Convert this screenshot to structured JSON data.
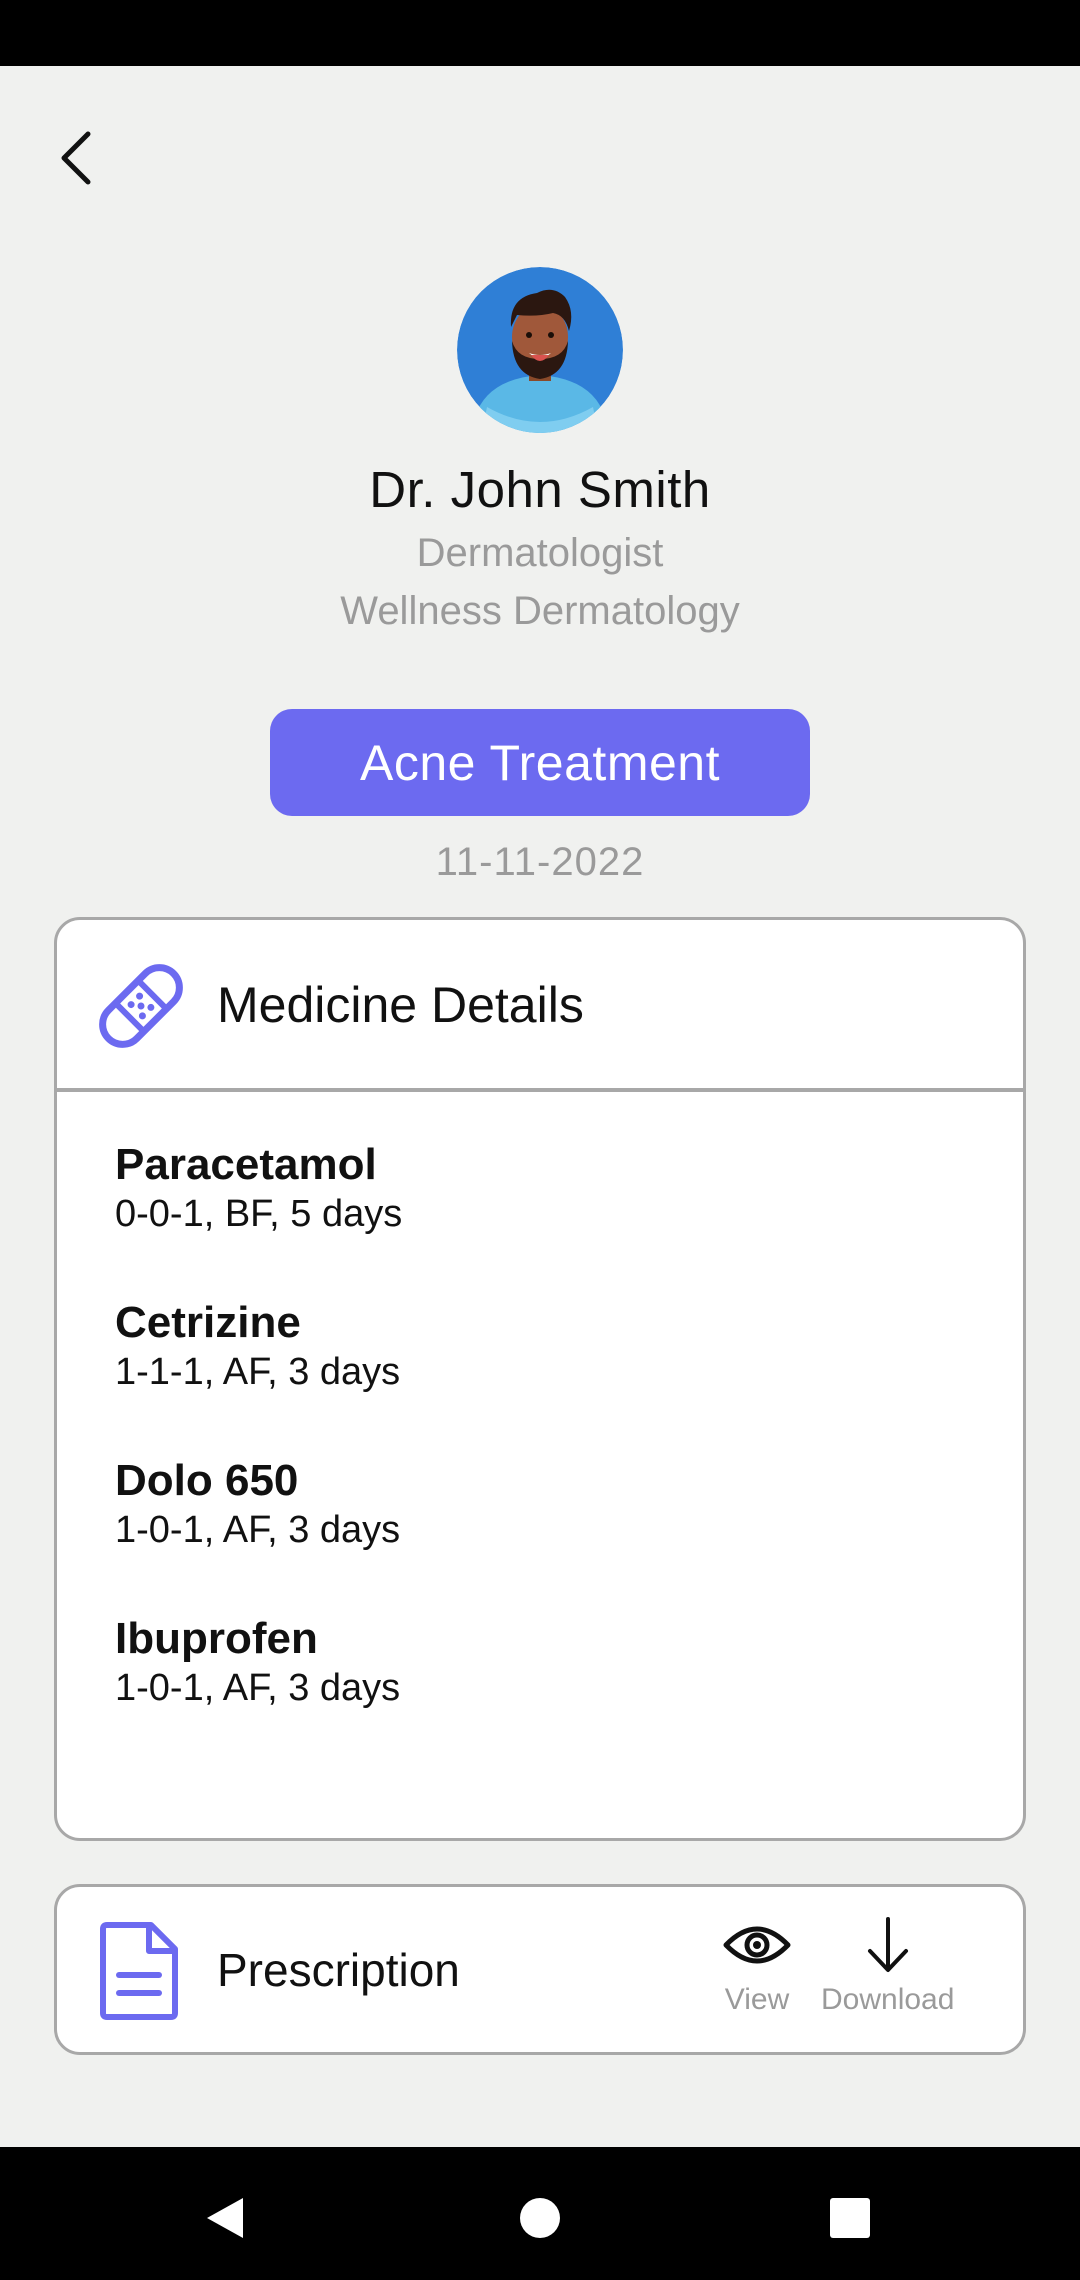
{
  "header": {
    "back_icon": "chevron-left-icon"
  },
  "doctor": {
    "avatar_icon": "doctor-avatar",
    "name": "Dr. John Smith",
    "specialty": "Dermatologist",
    "clinic": "Wellness Dermatology"
  },
  "appointment": {
    "treatment": "Acne Treatment",
    "date": "11-11-2022"
  },
  "medicine_card": {
    "icon": "bandage-icon",
    "title": "Medicine Details",
    "items": [
      {
        "name": "Paracetamol",
        "dosage": "0-0-1, BF, 5 days"
      },
      {
        "name": "Cetrizine",
        "dosage": "1-1-1, AF, 3 days"
      },
      {
        "name": "Dolo 650",
        "dosage": "1-0-1, AF, 3 days"
      },
      {
        "name": "Ibuprofen",
        "dosage": "1-0-1, AF, 3 days"
      }
    ]
  },
  "prescription_card": {
    "icon": "document-icon",
    "title": "Prescription",
    "view_label": "View",
    "download_label": "Download"
  },
  "colors": {
    "accent": "#6c6af0",
    "background": "#f0f1ef",
    "muted_text": "#9a9a9a",
    "border": "#a8a8a8"
  },
  "system_nav": {
    "back_icon": "nav-back-icon",
    "home_icon": "nav-home-icon",
    "recents_icon": "nav-recents-icon"
  }
}
